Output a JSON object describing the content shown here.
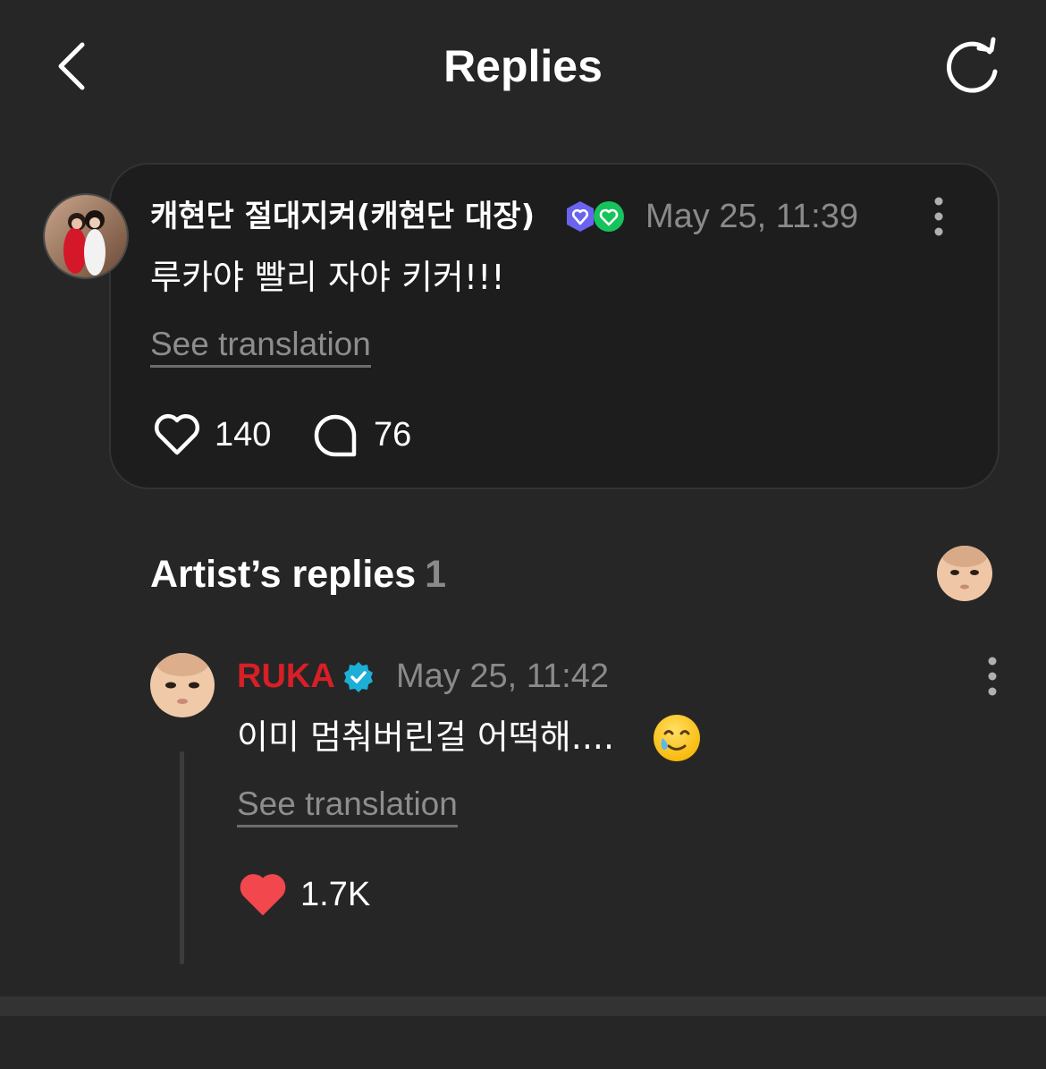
{
  "header": {
    "title": "Replies",
    "back_icon": "chevron-left-icon",
    "refresh_icon": "refresh-icon"
  },
  "post": {
    "username": "캐현단 절대지켜(캐현단 대장)",
    "badges": [
      "purple-heart-badge-icon",
      "green-heart-badge-icon"
    ],
    "timestamp": "May 25, 11:39",
    "text": "루카야 빨리 자야 키커!!!",
    "see_translation": "See translation",
    "likes": "140",
    "comments": "76"
  },
  "artist_replies": {
    "title": "Artist’s replies",
    "count": "1"
  },
  "reply": {
    "name": "RUKA",
    "timestamp": "May 25, 11:42",
    "text": "이미 멈춰버린걸 어떡해....",
    "emoji": "smiling-face-with-tear-emoji",
    "see_translation": "See translation",
    "likes": "1.7K"
  },
  "colors": {
    "background": "#262626",
    "card": "#1d1d1d",
    "artist_name": "#d71f26",
    "verified": "#1cb0d6",
    "liked_heart": "#f2474d",
    "muted_text": "#8a8a8a"
  }
}
